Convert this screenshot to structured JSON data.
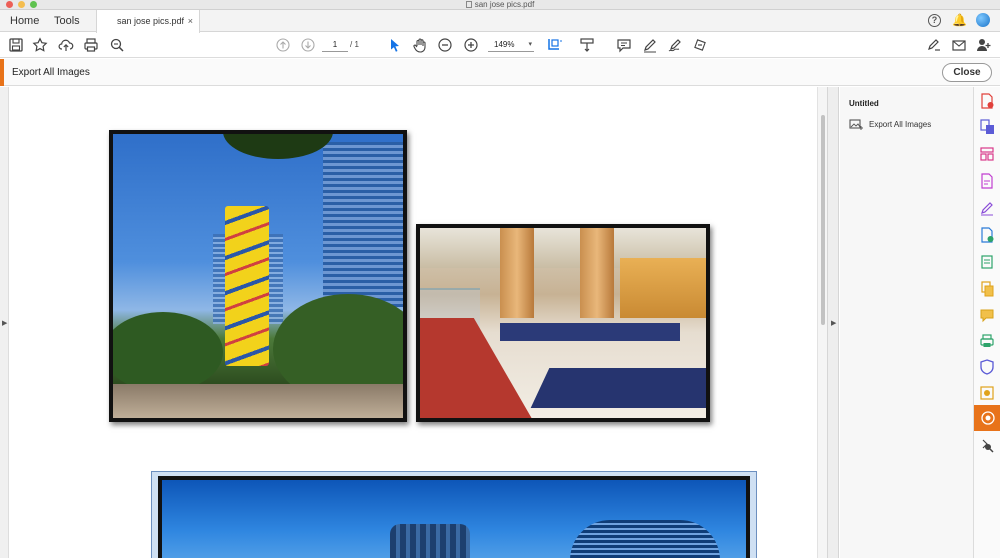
{
  "window": {
    "title": "san jose pics.pdf"
  },
  "tabs": {
    "home": "Home",
    "tools": "Tools",
    "document": "san jose pics.pdf",
    "close_glyph": "×"
  },
  "toolbar": {
    "page_current": "1",
    "page_total": "/ 1",
    "zoom": "149%"
  },
  "export_bar": {
    "title": "Export All Images",
    "close_label": "Close"
  },
  "right_panel": {
    "heading": "Untitled",
    "action_label": "Export All Images"
  },
  "colors": {
    "accent": "#e8731a",
    "tool_blue": "#1473e6"
  },
  "icons": {
    "toolbar": [
      "save-icon",
      "bookmark-star-icon",
      "upload-cloud-icon",
      "print-icon",
      "zoom-search-icon",
      "page-up-icon",
      "page-down-icon",
      "select-arrow-icon",
      "hand-icon",
      "zoom-out-icon",
      "zoom-in-icon",
      "marquee-fit-icon",
      "scroll-mode-icon",
      "comment-icon",
      "highlight-pen-icon",
      "sign-icon",
      "redact-icon",
      "signature-icon",
      "mail-icon",
      "add-user-icon"
    ],
    "rail": [
      "create-pdf-icon",
      "export-pdf-icon",
      "organize-pages-icon",
      "edit-pdf-icon",
      "fill-sign-icon",
      "compare-icon",
      "scan-icon",
      "combine-icon",
      "comment-icon",
      "print-production-icon",
      "protect-icon",
      "optimize-icon",
      "export-images-icon",
      "more-tools-icon"
    ]
  }
}
